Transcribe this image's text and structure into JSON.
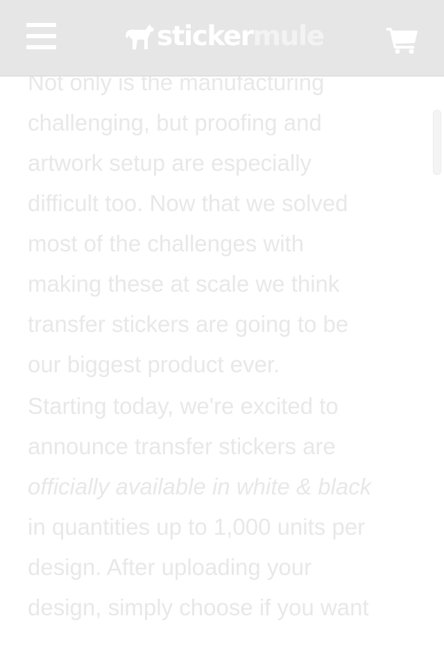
{
  "header": {
    "menu_icon": "hamburger-menu-icon",
    "logo_part1": "sticker",
    "logo_part2": "mule",
    "logo_icon": "mule-icon",
    "cart_icon": "shopping-cart-icon"
  },
  "colors": {
    "header_bg": "#e6e6e6",
    "text": "#e8e8e8",
    "background": "#ffffff"
  },
  "article": {
    "paragraph1_lines": [
      "Not only is the manufacturing",
      "challenging, but proofing and",
      "artwork setup are especially",
      "difficult too. Now that we solved",
      "most of the challenges with",
      "making these at scale we think",
      "transfer stickers are going to be",
      "our biggest product ever."
    ],
    "paragraph2": {
      "line1": "Starting today, we're excited to",
      "line2": "announce transfer stickers are",
      "line3_italic": "officially available in white & black",
      "line4": "in quantities up to 1,000 units per",
      "line5": "design. After uploading your",
      "line6": "design, simply choose if you want"
    }
  }
}
